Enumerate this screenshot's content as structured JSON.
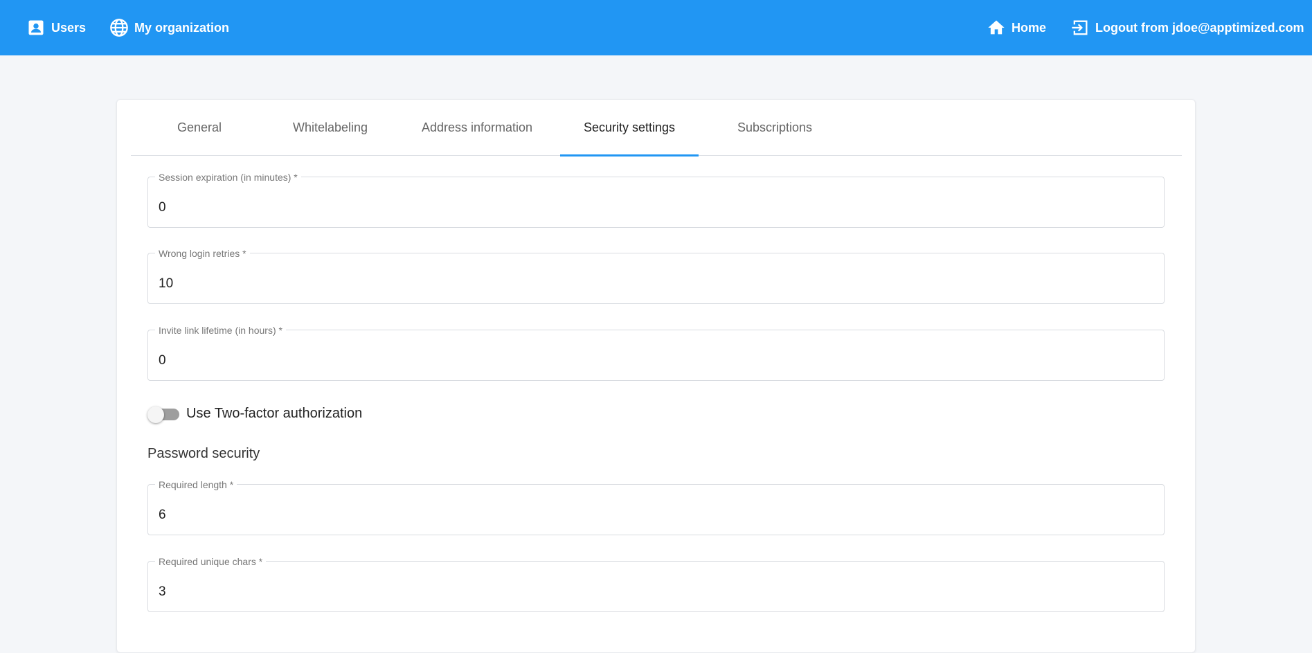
{
  "topbar": {
    "users_label": "Users",
    "org_label": "My organization",
    "home_label": "Home",
    "logout_label": "Logout from jdoe@apptimized.com",
    "background_color": "#2196f3"
  },
  "tabs": [
    {
      "label": "General",
      "active": false
    },
    {
      "label": "Whitelabeling",
      "active": false
    },
    {
      "label": "Address information",
      "active": false
    },
    {
      "label": "Security settings",
      "active": true
    },
    {
      "label": "Subscriptions",
      "active": false
    }
  ],
  "fields": {
    "session_expiration": {
      "label": "Session expiration (in minutes) *",
      "value": "0"
    },
    "wrong_login_retries": {
      "label": "Wrong login retries *",
      "value": "10"
    },
    "invite_link_lifetime": {
      "label": "Invite link lifetime (in hours) *",
      "value": "0"
    },
    "required_length": {
      "label": "Required length *",
      "value": "6"
    },
    "required_unique_chars": {
      "label": "Required unique chars *",
      "value": "3"
    }
  },
  "two_factor": {
    "label": "Use Two-factor authorization",
    "enabled": false
  },
  "password_section_title": "Password security",
  "accent_color": "#2196f3"
}
